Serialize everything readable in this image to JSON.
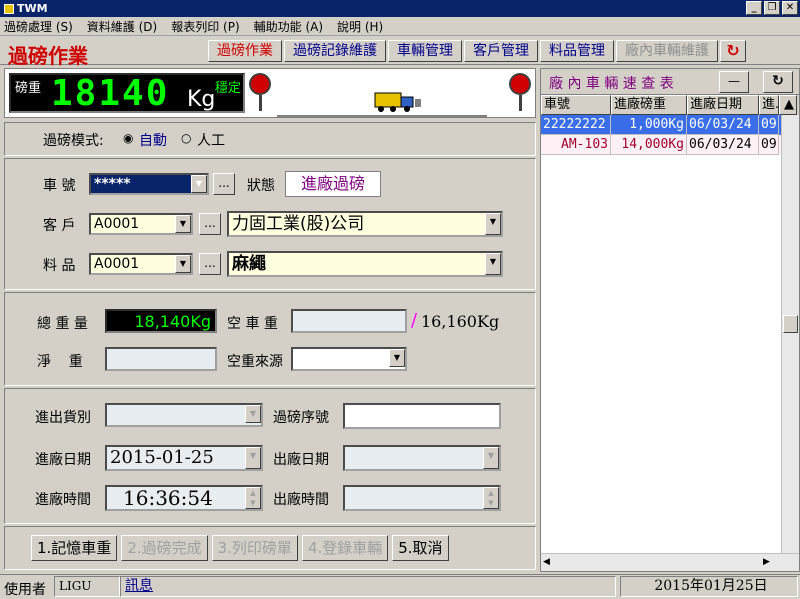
{
  "window": {
    "title": "TWM"
  },
  "menu": [
    "過磅處理 (S)",
    "資料維護 (D)",
    "報表列印 (P)",
    "輔助功能 (A)",
    "說明 (H)"
  ],
  "header": {
    "title": "過磅作業",
    "tabs": [
      {
        "label": "過磅作業",
        "state": "active"
      },
      {
        "label": "過磅記錄維護",
        "state": "normal"
      },
      {
        "label": "車輛管理",
        "state": "normal"
      },
      {
        "label": "客戶管理",
        "state": "normal"
      },
      {
        "label": "料品管理",
        "state": "normal"
      },
      {
        "label": "廠內車輛維護",
        "state": "disabled"
      }
    ]
  },
  "scale": {
    "label": "磅重",
    "value": "18140",
    "unit": "Kg",
    "stable": "穩定"
  },
  "mode": {
    "label": "過磅模式:",
    "auto": "自動",
    "manual": "人工",
    "selected": "auto"
  },
  "vehicle": {
    "label": "車 號",
    "value": "*****",
    "status_label": "狀態",
    "status_value": "進廠過磅",
    "more": "..."
  },
  "customer": {
    "label": "客 戶",
    "code": "A0001",
    "name": "力固工業(股)公司",
    "more": "..."
  },
  "material": {
    "label": "料 品",
    "code": "A0001",
    "name": "麻繩",
    "more": "..."
  },
  "weights": {
    "gross_label": "總 重 量",
    "gross_value": "18,140Kg",
    "tare_label": "空 車 重",
    "tare_value": "",
    "slash": "/",
    "tare_ref": "16,160Kg",
    "net_label": "淨    重",
    "net_value": "",
    "tare_source_label": "空重來源",
    "tare_source_value": ""
  },
  "info": {
    "goods_type_label": "進出貨別",
    "goods_type_value": "",
    "seq_label": "過磅序號",
    "seq_value": "",
    "in_date_label": "進廠日期",
    "in_date_value": "2015-01-25",
    "out_date_label": "出廠日期",
    "out_date_value": "",
    "in_time_label": "進廠時間",
    "in_time_value": "16:36:54",
    "out_time_label": "出廠時間",
    "out_time_value": ""
  },
  "buttons": [
    {
      "label": "1.記憶車重",
      "enabled": true
    },
    {
      "label": "2.過磅完成",
      "enabled": false
    },
    {
      "label": "3.列印磅單",
      "enabled": false
    },
    {
      "label": "4.登錄車輛",
      "enabled": false
    },
    {
      "label": "5.取消",
      "enabled": true
    }
  ],
  "lookup": {
    "title": "廠 內 車 輛 速 查 表",
    "min_label": "—",
    "columns": [
      "車號",
      "進廠磅重",
      "進廠日期",
      "進."
    ],
    "rows": [
      {
        "plate": "22222222",
        "weight": "1,000Kg",
        "date": "06/03/24",
        "time": "09",
        "selected": true
      },
      {
        "plate": "AM-103",
        "weight": "14,000Kg",
        "date": "06/03/24",
        "time": "09",
        "selected": false
      }
    ]
  },
  "status": {
    "user_label": "使用者",
    "user": "LIGU",
    "message_link": "訊息",
    "date": "2015年01月25日"
  },
  "colors": {
    "accent_red": "#d00000",
    "title_blue": "#0a246a",
    "lcd_green": "#00ff00",
    "selected_row": "#3a6ee8"
  }
}
